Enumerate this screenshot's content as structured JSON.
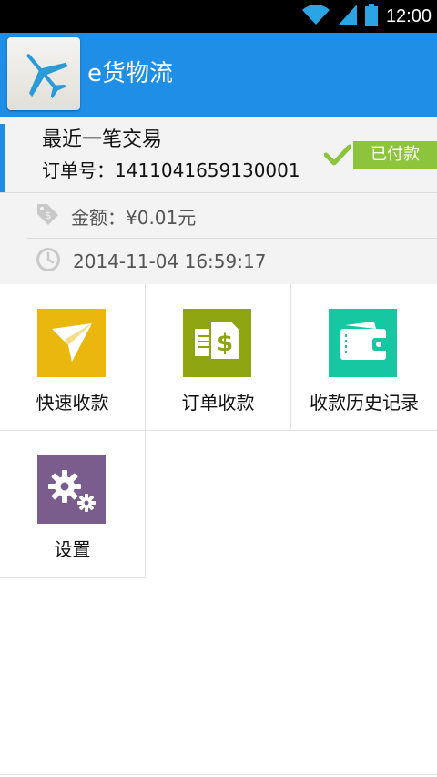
{
  "status_bar": {
    "time": "12:00",
    "icons": [
      "wifi-icon",
      "cell-signal-icon",
      "battery-icon"
    ]
  },
  "header": {
    "app_title": "e货物流",
    "logo_icon": "airplane-icon"
  },
  "recent": {
    "title": "最近一笔交易",
    "order_label": "订单号：",
    "order_number": "1411041659130001",
    "status": "已付款",
    "amount_label": "金额：",
    "amount_value": "¥0.01元",
    "time": "2014-11-04 16:59:17",
    "amount_icon": "price-tag-icon",
    "time_icon": "clock-icon"
  },
  "menu": [
    {
      "label": "快速收款",
      "icon": "paper-plane-icon",
      "color": "#e9b70d"
    },
    {
      "label": "订单收款",
      "icon": "invoice-dollar-icon",
      "color": "#8ea411"
    },
    {
      "label": "收款历史记录",
      "icon": "wallet-icon",
      "color": "#17c7a2"
    },
    {
      "label": "设置",
      "icon": "gears-icon",
      "color": "#7a5c8d"
    }
  ],
  "colors": {
    "primary": "#1e8ee6",
    "paid_badge": "#8cc43c",
    "status_bar": "#000000",
    "panel_bg": "#f3f3f3"
  }
}
